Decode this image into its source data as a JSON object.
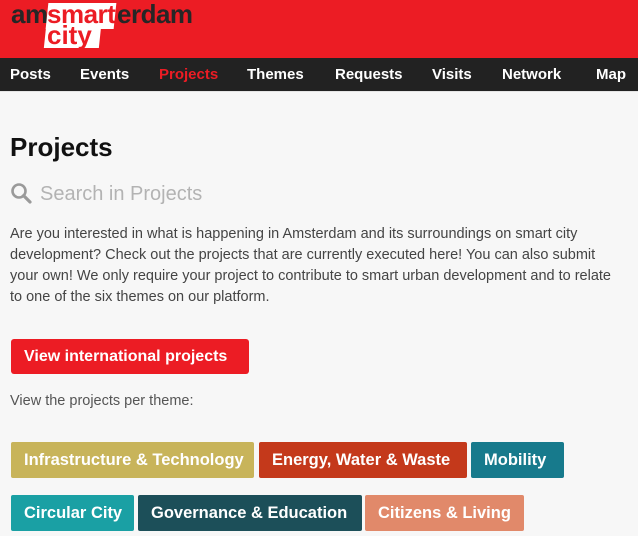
{
  "logo": {
    "part1": "am",
    "part2": "smart",
    "part3": "erdam",
    "part4": "city"
  },
  "nav": {
    "items": [
      {
        "label": "Posts"
      },
      {
        "label": "Events"
      },
      {
        "label": "Projects",
        "active": true
      },
      {
        "label": "Themes"
      },
      {
        "label": "Requests"
      },
      {
        "label": "Visits"
      },
      {
        "label": "Network"
      },
      {
        "label": "Map"
      }
    ]
  },
  "page": {
    "title": "Projects",
    "search_placeholder": "Search in Projects",
    "intro": "Are you interested in what is happening in Amsterdam and its surroundings on smart city development? Check out the projects that are currently executed here! You can also submit your own! We only require your project to contribute to smart urban development and to relate to one of the six themes on our platform.",
    "international_button": "View international projects",
    "per_theme_label": "View the projects per theme:"
  },
  "themes": [
    {
      "label": "Infrastructure & Technology",
      "color": "#c8b45a"
    },
    {
      "label": "Energy, Water & Waste",
      "color": "#c4391b"
    },
    {
      "label": "Mobility",
      "color": "#177a8c"
    },
    {
      "label": "Circular City",
      "color": "#1aa0a4"
    },
    {
      "label": "Governance & Education",
      "color": "#1c4f59"
    },
    {
      "label": "Citizens & Living",
      "color": "#e1896a"
    }
  ],
  "colors": {
    "brand": "#ec1c24",
    "nav_bg": "#222222"
  },
  "icons": {
    "search": "search-icon"
  }
}
